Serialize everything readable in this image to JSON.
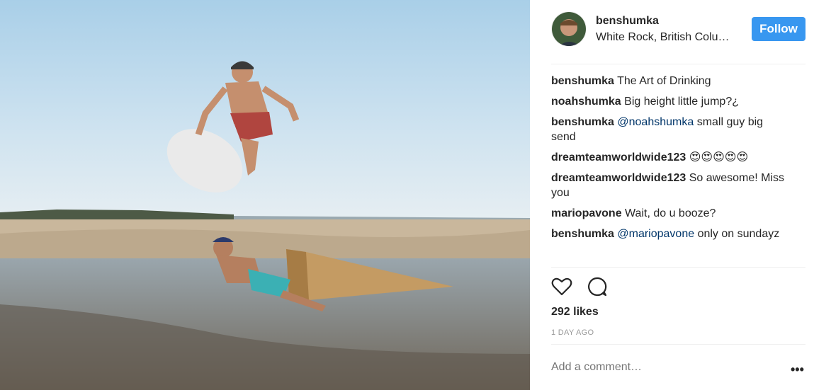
{
  "post": {
    "username": "benshumka",
    "location": "White Rock, British Columbia",
    "follow_label": "Follow"
  },
  "comments": [
    {
      "user": "benshumka",
      "text": "The Art of Drinking",
      "mention": ""
    },
    {
      "user": "noahshumka",
      "text": "Big height little jump?¿",
      "mention": ""
    },
    {
      "user": "benshumka",
      "mention": "@noahshumka",
      "text": "small guy big send"
    },
    {
      "user": "dreamteamworldwide123",
      "text": "😍😍😍😍😍",
      "mention": ""
    },
    {
      "user": "dreamteamworldwide123",
      "text": "So awesome! Miss you",
      "mention": ""
    },
    {
      "user": "mariopavone",
      "text": "Wait, do u booze?",
      "mention": ""
    },
    {
      "user": "benshumka",
      "mention": "@mariopavone",
      "text": "only on sundayz"
    }
  ],
  "stats": {
    "likes": "292 likes",
    "time_ago": "1 DAY AGO"
  },
  "comment_box": {
    "placeholder": "Add a comment…",
    "more_label": "•••"
  },
  "icons": {
    "like": "heart-icon",
    "comment": "comment-bubble-icon",
    "options": "more-options-icon"
  },
  "colors": {
    "follow_button": "#3897f0",
    "mention": "#003569",
    "muted": "#999999",
    "divider": "#efefef"
  }
}
